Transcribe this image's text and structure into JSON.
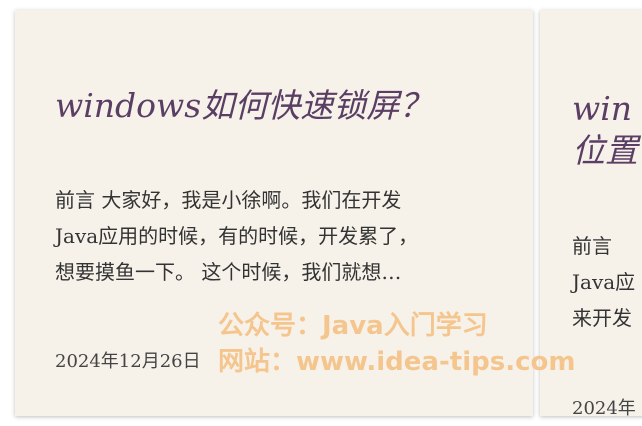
{
  "cards": [
    {
      "title": "windows如何快速锁屏？",
      "excerpt_lines": [
        "前言 大家好，我是小徐啊。我们在开发",
        "Java应用的时候，有的时候，开发累了，",
        "想要摸鱼一下。 这个时候，我们就想…"
      ],
      "date": "2024年12月26日"
    },
    {
      "title_lines": [
        "win",
        "位置"
      ],
      "excerpt_lines": [
        "前言",
        "Java应",
        "来开发"
      ],
      "date": "2024年"
    }
  ],
  "watermark": {
    "line1": "公众号：Java入门学习",
    "line2": "网站：www.idea-tips.com",
    "color": "#f5c38a"
  },
  "colors": {
    "card_background": "#f6f2ea",
    "title": "#5a3e63",
    "text": "#333333"
  }
}
